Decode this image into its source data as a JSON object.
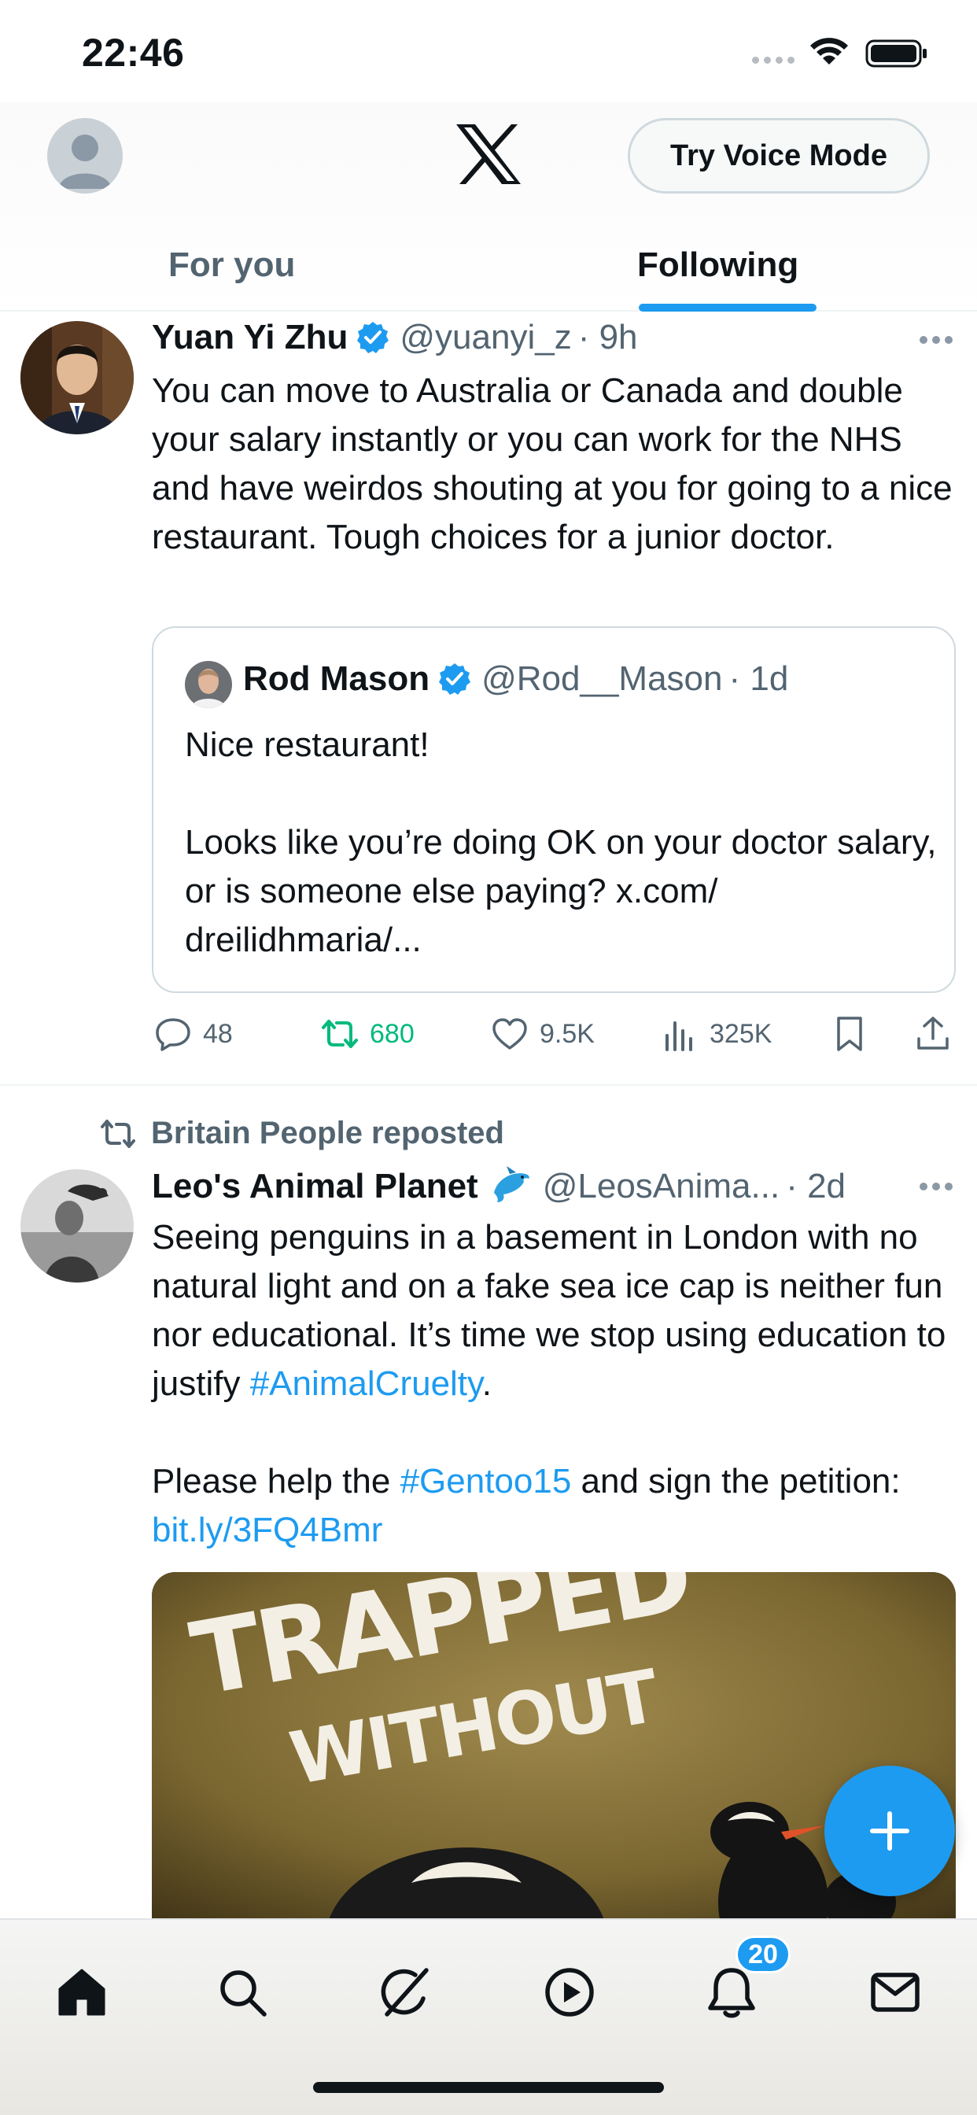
{
  "status_bar": {
    "time": "22:46",
    "icons": [
      "cellular-signal-icon",
      "wifi-icon",
      "battery-icon"
    ]
  },
  "header": {
    "logo": "x-logo",
    "voice_button": "Try Voice Mode",
    "tabs": [
      {
        "label": "For you",
        "selected": false
      },
      {
        "label": "Following",
        "selected": true
      }
    ]
  },
  "colors": {
    "accent": "#1d9bf0",
    "retweet_active": "#00ba7c",
    "secondary_text": "#536471",
    "primary_text": "#0f1419"
  },
  "feed": {
    "tweets": [
      {
        "name": "Yuan Yi Zhu",
        "verified": true,
        "handle": "@yuanyi_z",
        "time": "· 9h",
        "text": "You can move to Australia or Canada and double your salary instantly or you can work for the NHS and have weirdos shouting at you for going to a nice restaurant. Tough choices for a junior doctor.",
        "quote": {
          "name": "Rod Mason",
          "verified": true,
          "handle": "@Rod__Mason",
          "time": "· 1d",
          "text": "Nice restaurant!\n\nLooks like you’re doing OK on your doctor salary, or is someone else paying? x.com/\ndreilidhmaria/..."
        },
        "actions": {
          "replies": "48",
          "reposts": "680",
          "likes": "9.5K",
          "views": "325K",
          "reposted_by_me": true
        }
      },
      {
        "reposted_by": "Britain People reposted",
        "name": "Leo's Animal Planet",
        "name_emoji": "dolphin-icon",
        "handle": "@LeosAnima...",
        "time": "· 2d",
        "text_part1": "Seeing penguins in a basement in London with no natural light and on a fake sea ice cap is neither fun nor educational. It’s time we stop using education to justify ",
        "hashtag1": "#AnimalCruelty",
        "text_part2": ".\n\nPlease help the ",
        "hashtag2": "#Gentoo15",
        "text_part3": " and sign the petition: ",
        "link": "bit.ly/3FQ4Bmr",
        "media": {
          "headline_line1": "TRAPPED",
          "headline_line2": "WITHOUT"
        }
      }
    ]
  },
  "fab": {
    "icon": "plus-icon"
  },
  "bottom_nav": {
    "items": [
      "home-icon",
      "search-icon",
      "grok-icon",
      "video-icon",
      "notifications-icon",
      "messages-icon"
    ],
    "notifications_badge": "20"
  }
}
